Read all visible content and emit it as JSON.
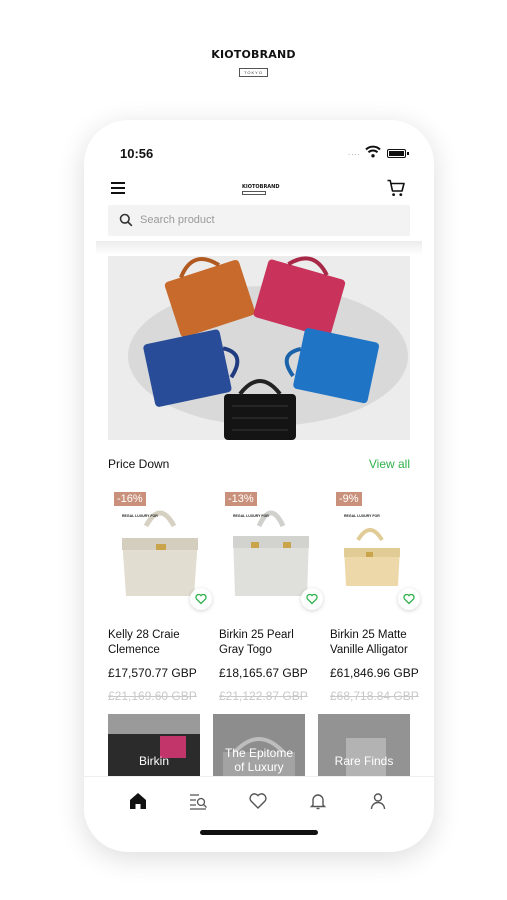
{
  "brand": {
    "name": "KIOTOBRAND",
    "tagline": "TOKYO"
  },
  "status_bar": {
    "time": "10:56",
    "signal_dots": "...."
  },
  "header": {
    "logo_text": "KIOTOBRAND"
  },
  "search": {
    "placeholder": "Search product"
  },
  "section": {
    "title": "Price Down",
    "view_all": "View all"
  },
  "products": [
    {
      "discount": "-16%",
      "tag": "REGAL LUXURY FOR",
      "name_line1": "Kelly 28 Craie",
      "name_line2": "Clemence",
      "price": "£17,570.77 GBP",
      "old_price": "£21,169.60 GBP",
      "color": "#e2ddd1"
    },
    {
      "discount": "-13%",
      "tag": "REGAL LUXURY FOR",
      "name_line1": "Birkin 25 Pearl",
      "name_line2": "Gray Togo",
      "price": "£18,165.67 GBP",
      "old_price": "£21,122.87 GBP",
      "color": "#dfdfdc"
    },
    {
      "discount": "-9%",
      "tag": "REGAL LUXURY FOR",
      "name_line1": "Birkin 25 Matte",
      "name_line2": "Vanille Alligator",
      "price": "£61,846.96 GBP",
      "old_price": "£68,718.84 GBP",
      "color": "#ecd8a8"
    }
  ],
  "categories": [
    {
      "label": "Birkin"
    },
    {
      "label": "The Epitome of Luxury"
    },
    {
      "label": "Rare Finds"
    }
  ],
  "tabbar": [
    "home-icon",
    "catalog-search-icon",
    "heart-icon",
    "bell-icon",
    "user-icon"
  ],
  "colors": {
    "accent_green": "#2fb14b",
    "discount_badge": "#c9917c",
    "old_price": "#c8c8c8"
  }
}
